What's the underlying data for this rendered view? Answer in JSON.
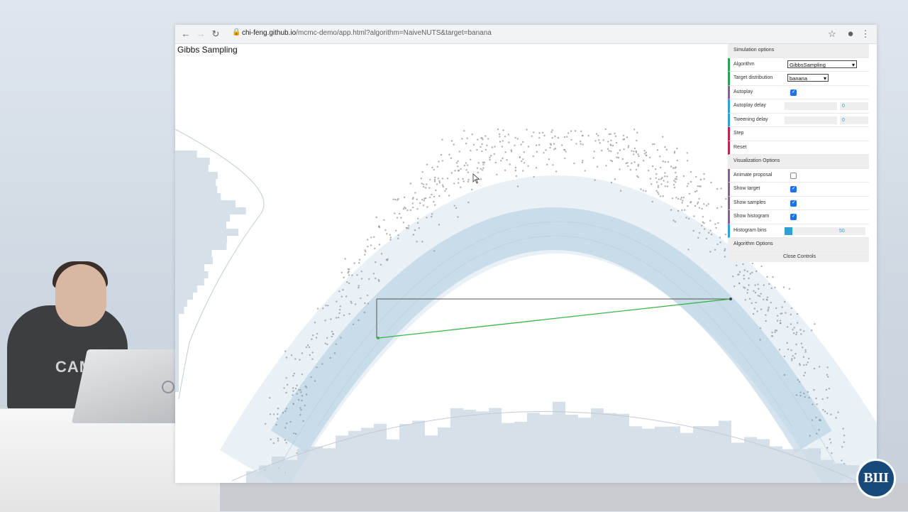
{
  "browser": {
    "url_host": "chi-feng.github.io",
    "url_path": "/mcmc-demo/app.html?algorithm=NaiveNUTS&target=banana"
  },
  "page": {
    "title": "Gibbs Sampling"
  },
  "panel": {
    "simulation_header": "Simulation options",
    "algorithm_label": "Algorithm",
    "algorithm_value": "GibbsSampling",
    "target_label": "Target distribution",
    "target_value": "banana",
    "autoplay_label": "Autoplay",
    "autoplay_checked": true,
    "autoplay_delay_label": "Autoplay delay",
    "autoplay_delay_value": "0",
    "tweening_delay_label": "Tweening delay",
    "tweening_delay_value": "0",
    "step_label": "Step",
    "reset_label": "Reset",
    "visualization_header": "Visualization Options",
    "animate_proposal_label": "Animate proposal",
    "animate_proposal_checked": false,
    "show_target_label": "Show target",
    "show_target_checked": true,
    "show_samples_label": "Show samples",
    "show_samples_checked": true,
    "show_histogram_label": "Show histogram",
    "show_histogram_checked": true,
    "histogram_bins_label": "Histogram bins",
    "histogram_bins_value": "50",
    "histogram_bins_fraction": 0.15,
    "algorithm_header": "Algorithm Options",
    "close_label": "Close Controls"
  },
  "overlay": {
    "shirt_text": "CAMP",
    "logo_text": "ВШ"
  },
  "colors": {
    "accent_blue": "#2fa1d6",
    "accent_green": "#2fa14c",
    "accent_red": "#c5244e",
    "histogram": "#c7d6e2",
    "density": "#a9c7dc",
    "proposal_line": "#3cb34a"
  }
}
